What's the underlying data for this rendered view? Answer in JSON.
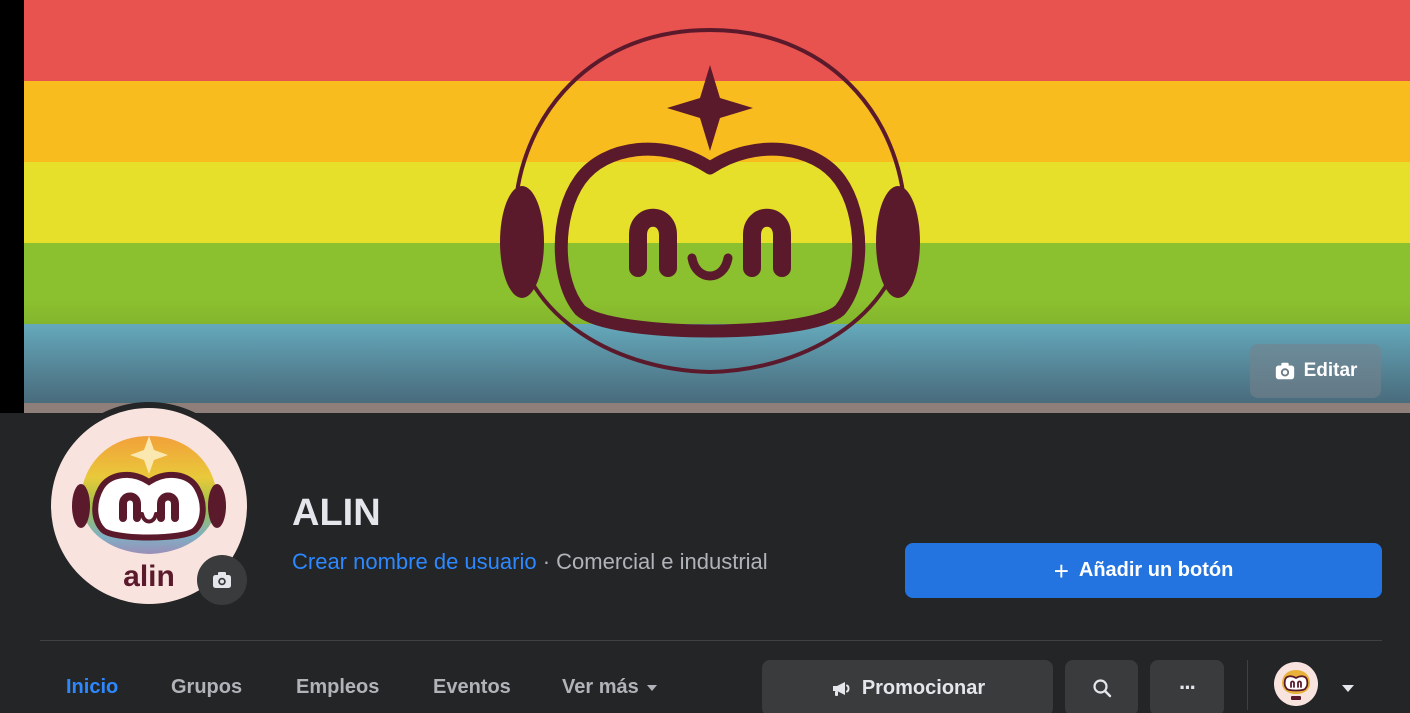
{
  "page": {
    "name": "ALIN",
    "username_link": "Crear nombre de usuario",
    "separator": " · ",
    "category": "Comercial e industrial"
  },
  "cover": {
    "edit_label": "Editar",
    "stripe_colors": [
      "#e8524f",
      "#f8bc1e",
      "#e6e02a",
      "#8bc02f",
      "#6ab3c6"
    ]
  },
  "avatar": {
    "brand_text": "alin"
  },
  "actions": {
    "add_button_plus": "+",
    "add_button_label": "Añadir un botón"
  },
  "tabs": [
    {
      "label": "Inicio",
      "active": true
    },
    {
      "label": "Grupos",
      "active": false
    },
    {
      "label": "Empleos",
      "active": false
    },
    {
      "label": "Eventos",
      "active": false
    },
    {
      "label": "Ver más",
      "active": false
    }
  ],
  "toolbar": {
    "promote_label": "Promocionar",
    "more_label": "···"
  },
  "colors": {
    "accent": "#2374e1",
    "link": "#2d88ff",
    "mascot_outline": "#5b1a2b"
  }
}
